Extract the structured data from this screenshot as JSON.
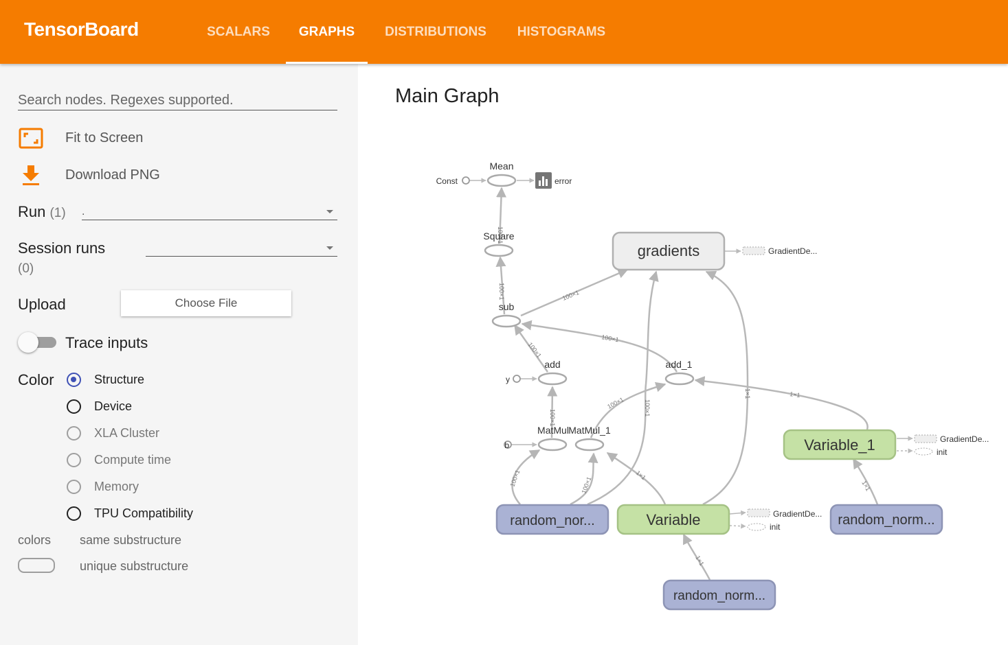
{
  "app": {
    "brand": "TensorBoard"
  },
  "tabs": [
    {
      "label": "SCALARS"
    },
    {
      "label": "GRAPHS",
      "active": true
    },
    {
      "label": "DISTRIBUTIONS"
    },
    {
      "label": "HISTOGRAMS"
    }
  ],
  "sidebar": {
    "search_placeholder": "Search nodes. Regexes supported.",
    "fit_to_screen": "Fit to Screen",
    "download_png": "Download PNG",
    "run_label": "Run",
    "run_count": "(1)",
    "run_value": ".",
    "session_label": "Session runs",
    "session_count": "(0)",
    "upload_label": "Upload",
    "choose_file": "Choose File",
    "trace_inputs": "Trace inputs",
    "color_label": "Color",
    "color_options": [
      {
        "label": "Structure",
        "state": "checked"
      },
      {
        "label": "Device",
        "state": "normal"
      },
      {
        "label": "XLA Cluster",
        "state": "disabled"
      },
      {
        "label": "Compute time",
        "state": "disabled"
      },
      {
        "label": "Memory",
        "state": "disabled"
      },
      {
        "label": "TPU Compatibility",
        "state": "normal"
      }
    ],
    "colors_legend": "colors",
    "same_substructure": "same substructure",
    "unique_substructure": "unique substructure"
  },
  "graph": {
    "title": "Main Graph",
    "nodes": {
      "mean": "Mean",
      "const": "Const",
      "error": "error",
      "square": "Square",
      "gradients": "gradients",
      "gradient_desc": "GradientDe...",
      "sub": "sub",
      "add": "add",
      "add_1": "add_1",
      "y": "y",
      "b": "b",
      "matmul": "MatMul",
      "matmul_1": "MatMul_1",
      "variable": "Variable",
      "variable_1": "Variable_1",
      "random_nor": "random_nor...",
      "random_norm_a": "random_norm...",
      "random_norm_b": "random_norm...",
      "init": "init"
    },
    "edge_labels": {
      "e100x1": "100×1",
      "e1x1": "1×1"
    }
  },
  "colors": {
    "accent": "#f57c00",
    "radio_checked": "#3f51b5",
    "node_gray": "#eeeeee",
    "node_blue": "#aab2d4",
    "node_green": "#c5e1a5"
  }
}
